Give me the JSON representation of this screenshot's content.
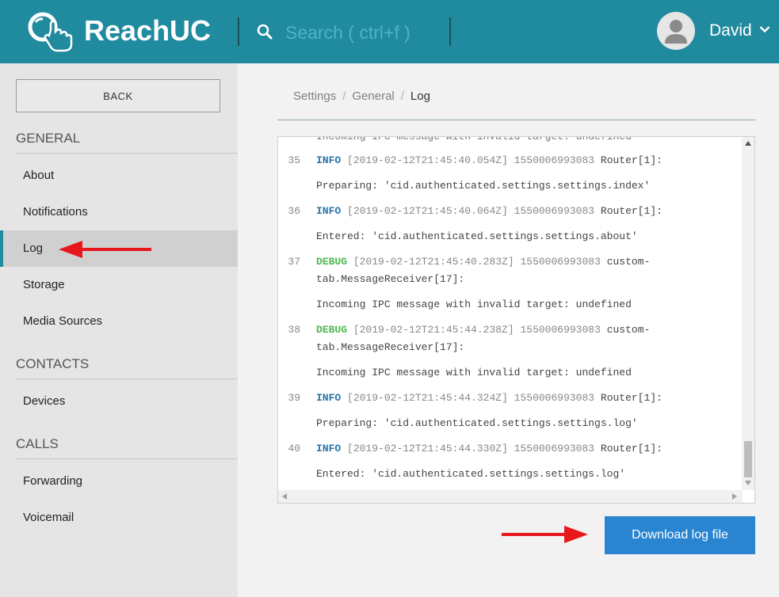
{
  "header": {
    "app_name": "ReachUC",
    "search_placeholder": "Search ( ctrl+f )",
    "user_name": "David",
    "colors": {
      "bar": "#208a9f",
      "accent": "#ffffff"
    }
  },
  "sidebar": {
    "back_label": "BACK",
    "sections": [
      {
        "title": "GENERAL",
        "items": [
          "About",
          "Notifications",
          "Log",
          "Storage",
          "Media Sources"
        ]
      },
      {
        "title": "CONTACTS",
        "items": [
          "Devices"
        ]
      },
      {
        "title": "CALLS",
        "items": [
          "Forwarding",
          "Voicemail"
        ]
      }
    ],
    "active_item": "Log"
  },
  "breadcrumb": [
    "Settings",
    "General",
    "Log"
  ],
  "log": {
    "partial_top_line": "Incoming IPC message with invalid target: undefined",
    "entries": [
      {
        "num": "35",
        "level": "INFO",
        "meta": "[2019-02-12T21:45:40.054Z] 1550006993083",
        "source": "Router[1]:",
        "source2": "",
        "message": "Preparing: 'cid.authenticated.settings.settings.index'"
      },
      {
        "num": "36",
        "level": "INFO",
        "meta": "[2019-02-12T21:45:40.064Z] 1550006993083",
        "source": "Router[1]:",
        "source2": "",
        "message": "Entered: 'cid.authenticated.settings.settings.about'"
      },
      {
        "num": "37",
        "level": "DEBUG",
        "meta": "[2019-02-12T21:45:40.283Z] 1550006993083",
        "source": "custom-",
        "source2": "tab.MessageReceiver[17]:",
        "message": "Incoming IPC message with invalid target: undefined"
      },
      {
        "num": "38",
        "level": "DEBUG",
        "meta": "[2019-02-12T21:45:44.238Z] 1550006993083",
        "source": "custom-",
        "source2": "tab.MessageReceiver[17]:",
        "message": "Incoming IPC message with invalid target: undefined"
      },
      {
        "num": "39",
        "level": "INFO",
        "meta": "[2019-02-12T21:45:44.324Z] 1550006993083",
        "source": "Router[1]:",
        "source2": "",
        "message": "Preparing: 'cid.authenticated.settings.settings.log'"
      },
      {
        "num": "40",
        "level": "INFO",
        "meta": "[2019-02-12T21:45:44.330Z] 1550006993083",
        "source": "Router[1]:",
        "source2": "",
        "message": "Entered: 'cid.authenticated.settings.settings.log'"
      }
    ],
    "level_colors": {
      "INFO": "#2a73a8",
      "DEBUG": "#4db84d"
    }
  },
  "download_label": "Download log file",
  "annotation_color": "#e8171c"
}
